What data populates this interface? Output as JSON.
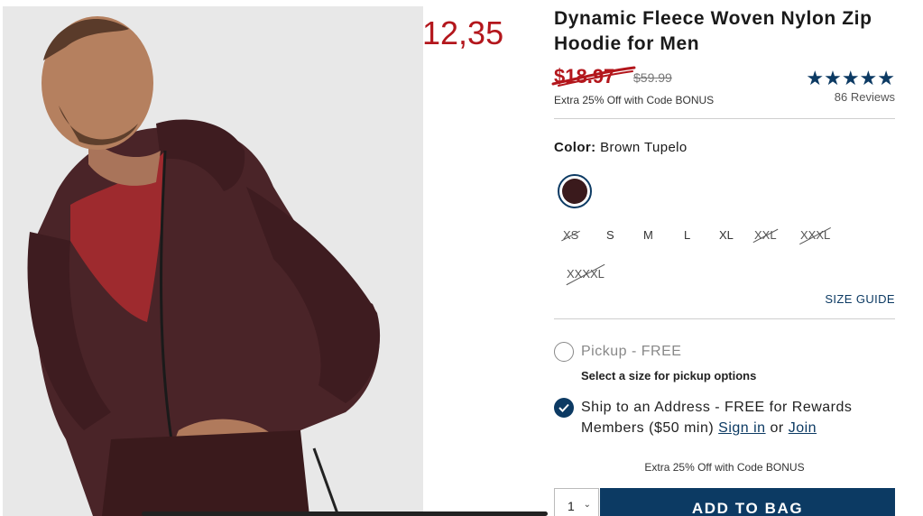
{
  "overlay_price": "12,35",
  "product": {
    "title": "Dynamic Fleece Woven Nylon Zip Hoodie for Men",
    "sale_price": "$18.97",
    "original_price": "$59.99",
    "promo": "Extra 25% Off with Code BONUS",
    "stars": "★★★★★",
    "reviews": "86 Reviews"
  },
  "color": {
    "label": "Color:",
    "value": "Brown Tupelo",
    "swatch_hex": "#3a1a1c"
  },
  "sizes": [
    {
      "label": "XS",
      "available": false
    },
    {
      "label": "S",
      "available": true
    },
    {
      "label": "M",
      "available": true
    },
    {
      "label": "L",
      "available": true
    },
    {
      "label": "XL",
      "available": true
    },
    {
      "label": "XXL",
      "available": false
    },
    {
      "label": "XXXL",
      "available": false
    },
    {
      "label": "XXXXL",
      "available": false
    }
  ],
  "size_guide": "SIZE GUIDE",
  "fulfillment": {
    "pickup_label": "Pickup - FREE",
    "pickup_note": "Select a size for pickup options",
    "ship_label": "Ship to an Address - FREE for Rewards Members ($50 min)",
    "sign_in": "Sign in",
    "or": "or",
    "join": "Join"
  },
  "promo_bottom": "Extra 25% Off with Code BONUS",
  "quantity": "1",
  "add_to_bag": "ADD TO BAG",
  "colors": {
    "accent": "#0c3a63",
    "sale_red": "#b3161c"
  }
}
